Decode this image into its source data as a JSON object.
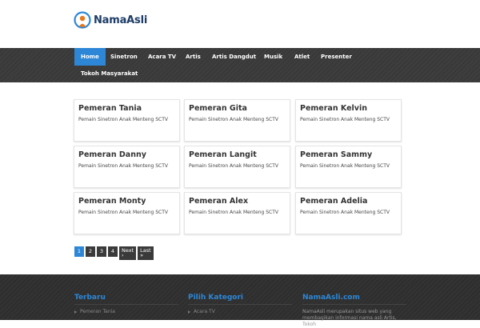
{
  "site": {
    "logo_text": "NamaAsli"
  },
  "nav": {
    "items": [
      {
        "label": "Home",
        "active": true
      },
      {
        "label": "Sinetron"
      },
      {
        "label": "Acara TV"
      },
      {
        "label": "Artis"
      },
      {
        "label": "Artis Dangdut"
      },
      {
        "label": "Musik"
      },
      {
        "label": "Atlet"
      },
      {
        "label": "Presenter"
      },
      {
        "label": "Tokoh Masyarakat"
      }
    ]
  },
  "cards": [
    {
      "title": "Pemeran Tania",
      "subtitle": "Pemain Sinetron Anak Menteng SCTV"
    },
    {
      "title": "Pemeran Gita",
      "subtitle": "Pemain Sinetron Anak Menteng SCTV"
    },
    {
      "title": "Pemeran Kelvin",
      "subtitle": "Pemain Sinetron Anak Menteng SCTV"
    },
    {
      "title": "Pemeran Danny",
      "subtitle": "Pemain Sinetron Anak Menteng SCTV"
    },
    {
      "title": "Pemeran Langit",
      "subtitle": "Pemain Sinetron Anak Menteng SCTV"
    },
    {
      "title": "Pemeran Sammy",
      "subtitle": "Pemain Sinetron Anak Menteng SCTV"
    },
    {
      "title": "Pemeran Monty",
      "subtitle": "Pemain Sinetron Anak Menteng SCTV"
    },
    {
      "title": "Pemeran Alex",
      "subtitle": "Pemain Sinetron Anak Menteng SCTV"
    },
    {
      "title": "Pemeran Adelia",
      "subtitle": "Pemain Sinetron Anak Menteng SCTV"
    }
  ],
  "pagination": {
    "pages": [
      "1",
      "2",
      "3",
      "4"
    ],
    "current": "1",
    "next_label": "Next",
    "next_arrow": "›",
    "last_label": "Last",
    "last_arrow": "»"
  },
  "footer": {
    "col1": {
      "title": "Terbaru",
      "item": "Pemeran Tania"
    },
    "col2": {
      "title": "Pilih Kategori",
      "item": "Acara TV"
    },
    "col3": {
      "title": "NamaAsli.com",
      "text": "NamaAsli merupakan situs web yang membagikan informasi nama asli Artis, Tokoh"
    }
  },
  "colors": {
    "accent": "#2d87d6",
    "nav_bg": "#3a3a3a",
    "footer_bg": "#2f2f2f",
    "logo_text": "#1d3c66"
  }
}
